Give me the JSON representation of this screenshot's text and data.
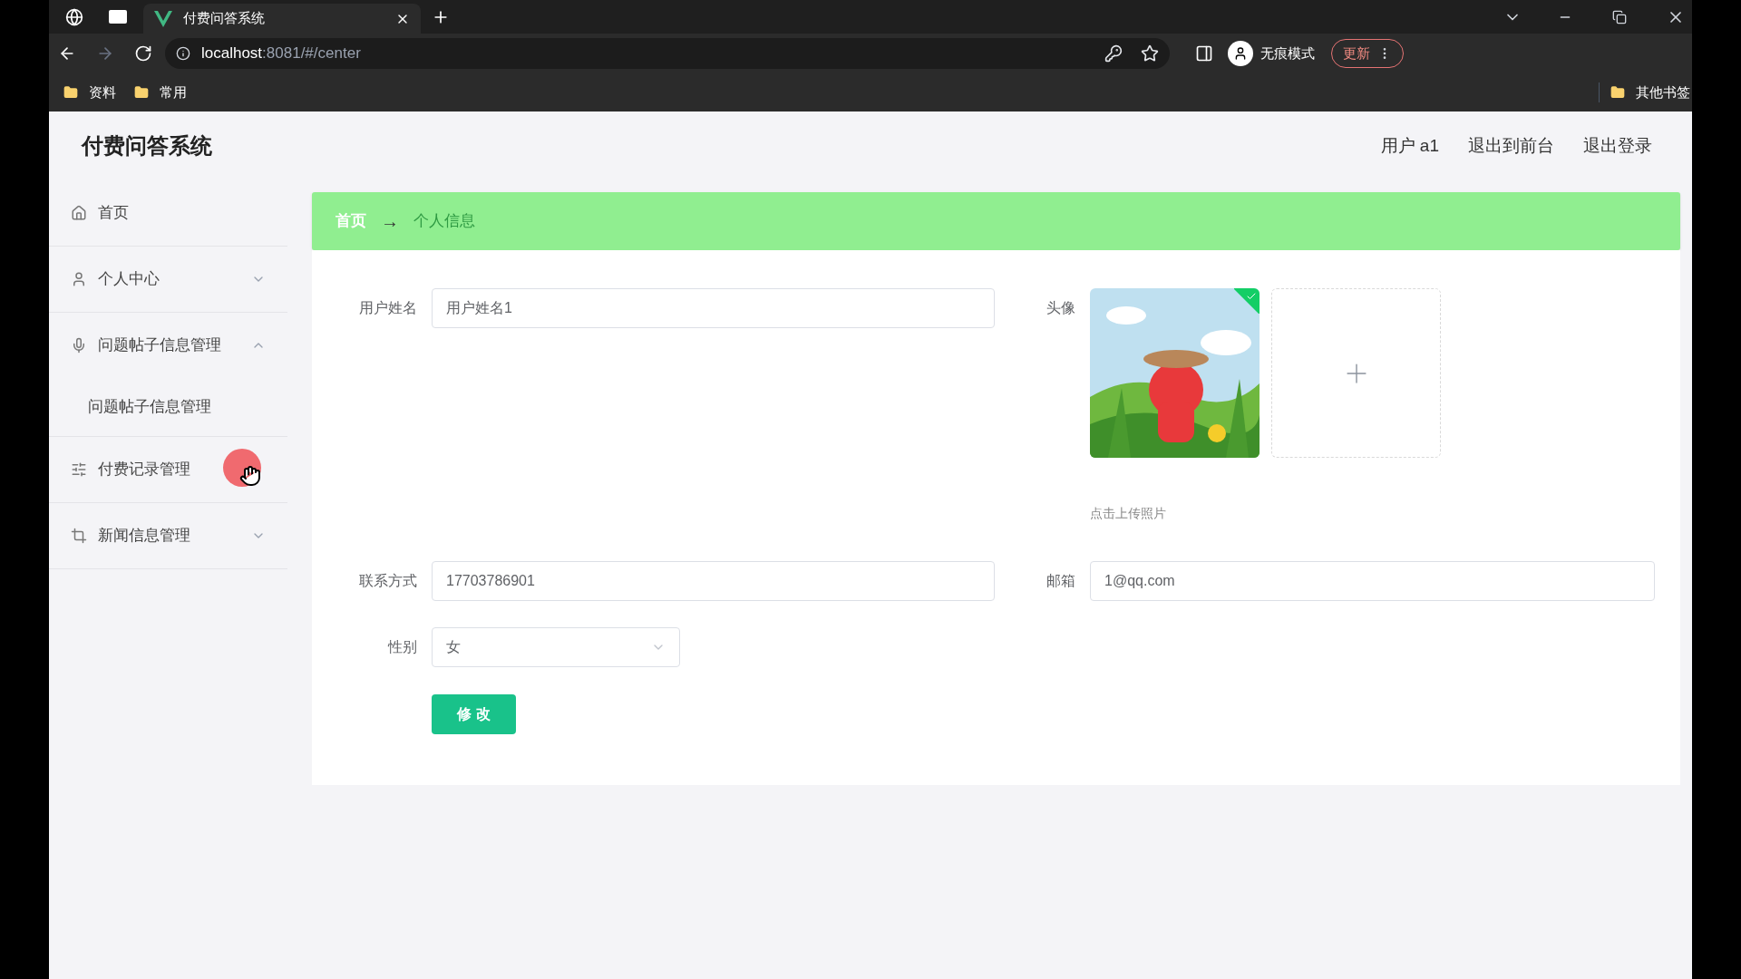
{
  "browser": {
    "tabs": [
      {
        "title": "付费问答系统",
        "selected": true
      }
    ],
    "address": {
      "host": "localhost",
      "path": ":8081/#/center"
    },
    "incognito_label": "无痕模式",
    "update_button": "更新",
    "bookmarks": [
      "资料",
      "常用"
    ],
    "other_bookmarks": "其他书签"
  },
  "app": {
    "title": "付费问答系统",
    "user_menu": [
      "用户 a1",
      "退出到前台",
      "退出登录"
    ],
    "sidebar": {
      "items": [
        {
          "label": "首页"
        },
        {
          "label": "个人中心",
          "expanded": false
        },
        {
          "label": "问题帖子信息管理",
          "expanded": true,
          "children": [
            {
              "label": "问题帖子信息管理"
            }
          ]
        },
        {
          "label": "付费记录管理"
        },
        {
          "label": "新闻信息管理",
          "expanded": false
        }
      ]
    },
    "breadcrumb": [
      "首页",
      "个人信息"
    ],
    "breadcrumb_separator": "→",
    "form": {
      "username": {
        "label": "用户姓名",
        "value": "用户姓名1"
      },
      "avatar": {
        "label": "头像",
        "uploaded": true,
        "hint": "点击上传照片"
      },
      "phone": {
        "label": "联系方式",
        "value": "17703786901"
      },
      "email": {
        "label": "邮箱",
        "value": "1@qq.com"
      },
      "gender": {
        "label": "性别",
        "value": "女"
      },
      "submit": "修 改"
    }
  }
}
